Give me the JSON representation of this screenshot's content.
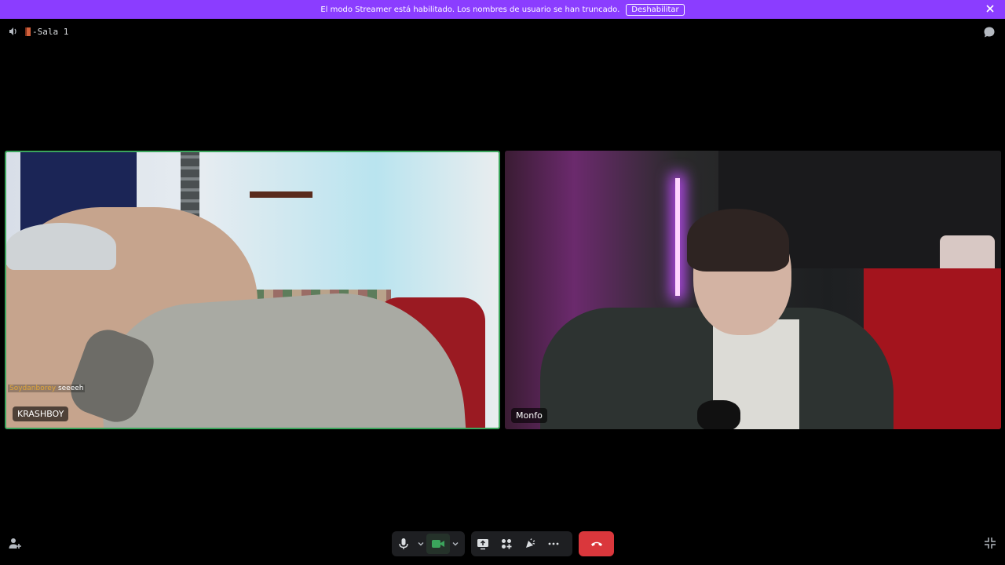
{
  "banner": {
    "message": "El modo Streamer está habilitado. Los nombres de usuario se han truncado.",
    "button_label": "Deshabilitar",
    "color": "#8b3dff"
  },
  "header": {
    "channel_name": "-Sala 1",
    "icons": [
      "speaker-icon",
      "door-icon",
      "chat-bubble-icon"
    ]
  },
  "tiles": [
    {
      "name": "KRASHBOY",
      "speaking": true,
      "overlay_user": "Soydanborey",
      "overlay_text": "seeeeh"
    },
    {
      "name": "Monfo",
      "speaking": false
    }
  ],
  "controls": {
    "icons": [
      "add-person-icon",
      "microphone-icon",
      "chevron-down-icon",
      "camera-icon",
      "chevron-down-icon",
      "screen-share-icon",
      "activities-icon",
      "soundboard-icon",
      "more-icon",
      "hang-up-icon",
      "exit-fullscreen-icon"
    ],
    "camera_active_color": "#3ba55c",
    "hangup_color": "#da373c"
  }
}
